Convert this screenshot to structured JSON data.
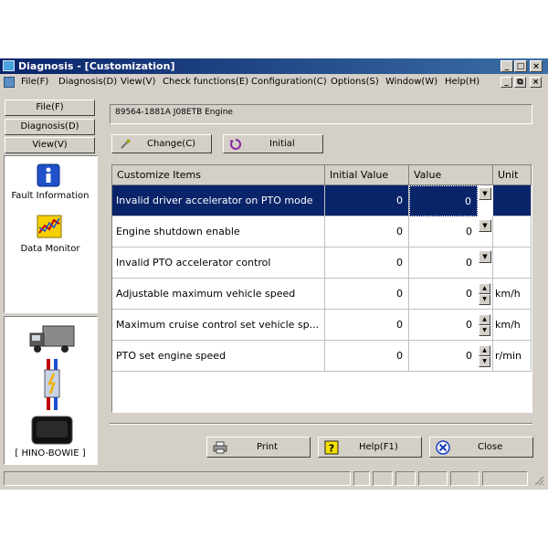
{
  "window": {
    "title": "Diagnosis - [Customization]",
    "caption_buttons": [
      "_",
      "□",
      "×"
    ],
    "mdi_buttons": [
      "_",
      "⧉",
      "×"
    ]
  },
  "menu": [
    "File(F)",
    "Diagnosis(D)",
    "View(V)",
    "Check functions(E)",
    "Configuration(C)",
    "Options(S)",
    "Window(W)",
    "Help(H)"
  ],
  "sidebar": {
    "buttons": [
      "File(F)",
      "Diagnosis(D)",
      "View(V)"
    ],
    "items": [
      {
        "label": "Fault Information",
        "icon": "info-icon"
      },
      {
        "label": "Data Monitor",
        "icon": "chart-icon"
      }
    ],
    "device_label": "[ HINO-BOWIE ]"
  },
  "vehicle": "89564-1881A J08ETB Engine",
  "toolbar": {
    "change": "Change(C)",
    "initial": "Initial"
  },
  "table": {
    "headers": [
      "Customize Items",
      "Initial Value",
      "Value",
      "Unit"
    ],
    "rows": [
      {
        "name": "Invalid driver accelerator on PTO mode",
        "initial": "0",
        "value": "0",
        "unit": "",
        "control": "dropdown",
        "selected": true
      },
      {
        "name": "Engine shutdown enable",
        "initial": "0",
        "value": "0",
        "unit": "",
        "control": "dropdown"
      },
      {
        "name": "Invalid PTO accelerator control",
        "initial": "0",
        "value": "0",
        "unit": "",
        "control": "dropdown"
      },
      {
        "name": "Adjustable maximum vehicle speed",
        "initial": "0",
        "value": "0",
        "unit": "km/h",
        "control": "spin"
      },
      {
        "name": "Maximum cruise control set vehicle sp...",
        "initial": "0",
        "value": "0",
        "unit": "km/h",
        "control": "spin"
      },
      {
        "name": "PTO set engine speed",
        "initial": "0",
        "value": "0",
        "unit": "r/min",
        "control": "spin"
      }
    ]
  },
  "bottom": {
    "print": "Print",
    "help": "Help(F1)",
    "close": "Close"
  },
  "colors": {
    "selection": "#0a246a",
    "titlebar": "#0a246a",
    "face": "#d4d0c8"
  }
}
